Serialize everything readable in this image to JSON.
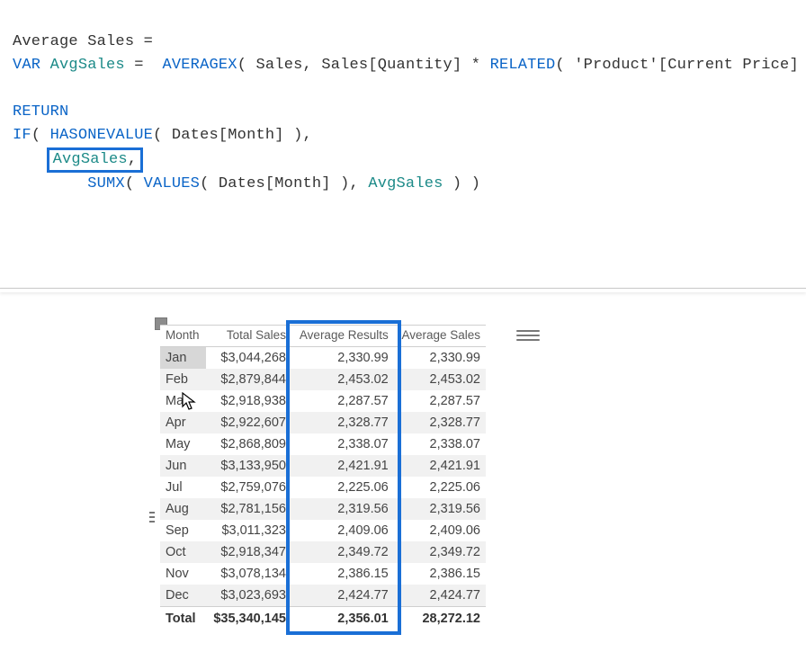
{
  "formula": {
    "measure_name": "Average Sales",
    "equals": "=",
    "var_kw": "VAR",
    "var_name": "AvgSales",
    "assign": "=",
    "averagex": "AVERAGEX",
    "sales_tbl": "Sales",
    "sales_qty": "Sales[Quantity]",
    "star": "*",
    "related": "RELATED",
    "product_price": "'Product'[Current Price]",
    "return_kw": "RETURN",
    "if_fn": "IF",
    "hasonevalue": "HASONEVALUE",
    "dates_month": "Dates[Month]",
    "avgsales_ref1": "AvgSales",
    "comma1": ",",
    "sumx": "SUMX",
    "values_fn": "VALUES",
    "avgsales_ref2": "AvgSales"
  },
  "table": {
    "headers": {
      "month": "Month",
      "total": "Total Sales",
      "avg_results": "Average Results",
      "avg_sales": "Average Sales"
    },
    "rows": [
      {
        "month": "Jan",
        "total": "$3,044,268",
        "avg_results": "2,330.99",
        "avg_sales": "2,330.99"
      },
      {
        "month": "Feb",
        "total": "$2,879,844",
        "avg_results": "2,453.02",
        "avg_sales": "2,453.02"
      },
      {
        "month": "Mar",
        "total": "$2,918,938",
        "avg_results": "2,287.57",
        "avg_sales": "2,287.57"
      },
      {
        "month": "Apr",
        "total": "$2,922,607",
        "avg_results": "2,328.77",
        "avg_sales": "2,328.77"
      },
      {
        "month": "May",
        "total": "$2,868,809",
        "avg_results": "2,338.07",
        "avg_sales": "2,338.07"
      },
      {
        "month": "Jun",
        "total": "$3,133,950",
        "avg_results": "2,421.91",
        "avg_sales": "2,421.91"
      },
      {
        "month": "Jul",
        "total": "$2,759,076",
        "avg_results": "2,225.06",
        "avg_sales": "2,225.06"
      },
      {
        "month": "Aug",
        "total": "$2,781,156",
        "avg_results": "2,319.56",
        "avg_sales": "2,319.56"
      },
      {
        "month": "Sep",
        "total": "$3,011,323",
        "avg_results": "2,409.06",
        "avg_sales": "2,409.06"
      },
      {
        "month": "Oct",
        "total": "$2,918,347",
        "avg_results": "2,349.72",
        "avg_sales": "2,349.72"
      },
      {
        "month": "Nov",
        "total": "$3,078,134",
        "avg_results": "2,386.15",
        "avg_sales": "2,386.15"
      },
      {
        "month": "Dec",
        "total": "$3,023,693",
        "avg_results": "2,424.77",
        "avg_sales": "2,424.77"
      }
    ],
    "totals": {
      "label": "Total",
      "total": "$35,340,145",
      "avg_results": "2,356.01",
      "avg_sales": "28,272.12"
    }
  }
}
